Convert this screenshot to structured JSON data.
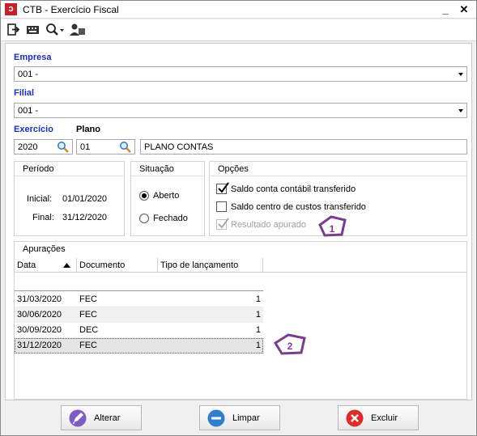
{
  "window": {
    "title": "CTB - Exercício Fiscal",
    "app_icon": "ctb-app-icon",
    "minimize": "_",
    "close": "✕"
  },
  "toolbar": {
    "icons": [
      "exit-icon",
      "keyboard-icon",
      "search-dropdown-icon",
      "user-icon"
    ]
  },
  "form": {
    "empresa": {
      "label": "Empresa",
      "value": "001 -"
    },
    "filial": {
      "label": "Filial",
      "value": "001 -"
    },
    "exercicio": {
      "label": "Exercício",
      "value": "2020"
    },
    "plano": {
      "label": "Plano",
      "code": "01",
      "description": "PLANO CONTAS"
    }
  },
  "periodo": {
    "title": "Período",
    "inicial_label": "Inicial:",
    "inicial_value": "01/01/2020",
    "final_label": "Final:",
    "final_value": "31/12/2020"
  },
  "situacao": {
    "title": "Situação",
    "options": [
      {
        "label": "Aberto",
        "selected": true
      },
      {
        "label": "Fechado",
        "selected": false
      }
    ]
  },
  "opcoes": {
    "title": "Opções",
    "items": [
      {
        "label": "Saldo conta contábil transferido",
        "checked": true,
        "enabled": true
      },
      {
        "label": "Saldo centro de custos transferido",
        "checked": false,
        "enabled": true
      },
      {
        "label": "Resultado apurado",
        "checked": true,
        "enabled": false
      }
    ]
  },
  "apuracoes": {
    "title": "Apurações",
    "columns": [
      "Data",
      "Documento",
      "Tipo de lançamento"
    ],
    "rows": [
      {
        "data": "31/03/2020",
        "documento": "FEC",
        "tipo": "1"
      },
      {
        "data": "30/06/2020",
        "documento": "FEC",
        "tipo": "1"
      },
      {
        "data": "30/09/2020",
        "documento": "DEC",
        "tipo": "1"
      },
      {
        "data": "31/12/2020",
        "documento": "FEC",
        "tipo": "1"
      }
    ]
  },
  "buttons": {
    "alterar": "Alterar",
    "limpar": "Limpar",
    "excluir": "Excluir"
  },
  "callouts": [
    "1",
    "2"
  ],
  "colors": {
    "label_blue": "#1b2fbf",
    "callout_purple": "#7b3a96",
    "app_red": "#c8202a"
  }
}
